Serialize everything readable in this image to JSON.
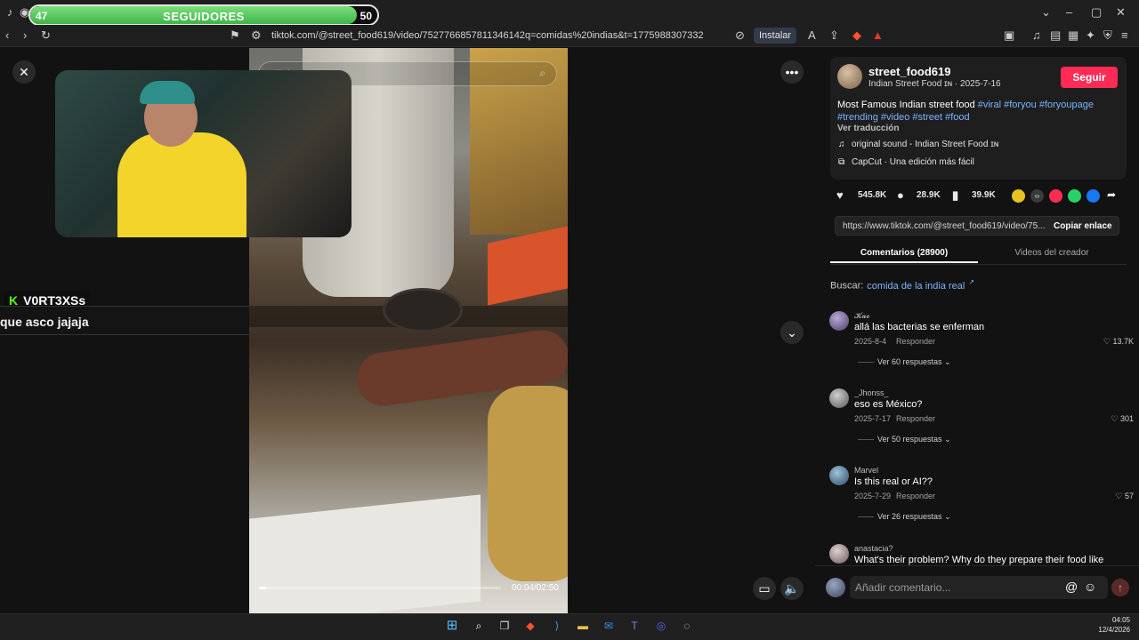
{
  "browser": {
    "url": "tiktok.com/@street_food619/video/7527766857811346142q=comidas%20indias&t=1775988307332",
    "install_label": "Instalar"
  },
  "follower_goal": {
    "current": "47",
    "label": "SEGUIDORES",
    "goal": "50",
    "progress_fraction": 0.94
  },
  "video": {
    "search_placeholder": "llejera",
    "time": "00:04/02:50",
    "progress_fraction": 0.03
  },
  "chat": {
    "username": "V0RT3XSs",
    "message": "que asco jajaja"
  },
  "post": {
    "username": "street_food619",
    "meta": "Indian Street Food ɪɴ · 2025-7-16",
    "follow_label": "Seguir",
    "description": "Most Famous Indian street food",
    "hashtags_line1": "#viral #foryou #foryoupage",
    "hashtags_line2": "#trending #video #street #food",
    "translate": "Ver traducción",
    "sound": "original sound - Indian Street Food ɪɴ",
    "capcut": "CapCut · Una edición más fácil",
    "likes": "545.8K",
    "comments": "28.9K",
    "saves": "39.9K",
    "link": "https://www.tiktok.com/@street_food619/video/75...",
    "copy_label": "Copiar enlace"
  },
  "tabs": {
    "comments": "Comentarios (28900)",
    "videos": "Videos del creador"
  },
  "search": {
    "label": "Buscar:",
    "query": "comida de la india real"
  },
  "comments": [
    {
      "name": "𝓚𝓪𝓸",
      "text": "allá las bacterias se enferman",
      "date": "2025-8-4",
      "reply": "Responder",
      "likes": "13.7K",
      "more": "Ver 60 respuestas"
    },
    {
      "name": "_Jhonss_",
      "text": "eso es México?",
      "date": "2025-7-17",
      "reply": "Responder",
      "likes": "301",
      "more": "Ver 50 respuestas"
    },
    {
      "name": "Marvel",
      "text": "Is this real or AI??",
      "date": "2025-7-29",
      "reply": "Responder",
      "likes": "57",
      "more": "Ver 26 respuestas"
    },
    {
      "name": "anastacia?",
      "text": "What's their problem? Why do they prepare their food like"
    }
  ],
  "comment_input": {
    "placeholder": "Añadir comentario..."
  },
  "clock": {
    "time": "04:05",
    "date": "12/4/2026"
  },
  "colors": {
    "accent": "#fe2c55",
    "hashtag": "#7cb3ff",
    "kick_green": "#53fc18"
  }
}
